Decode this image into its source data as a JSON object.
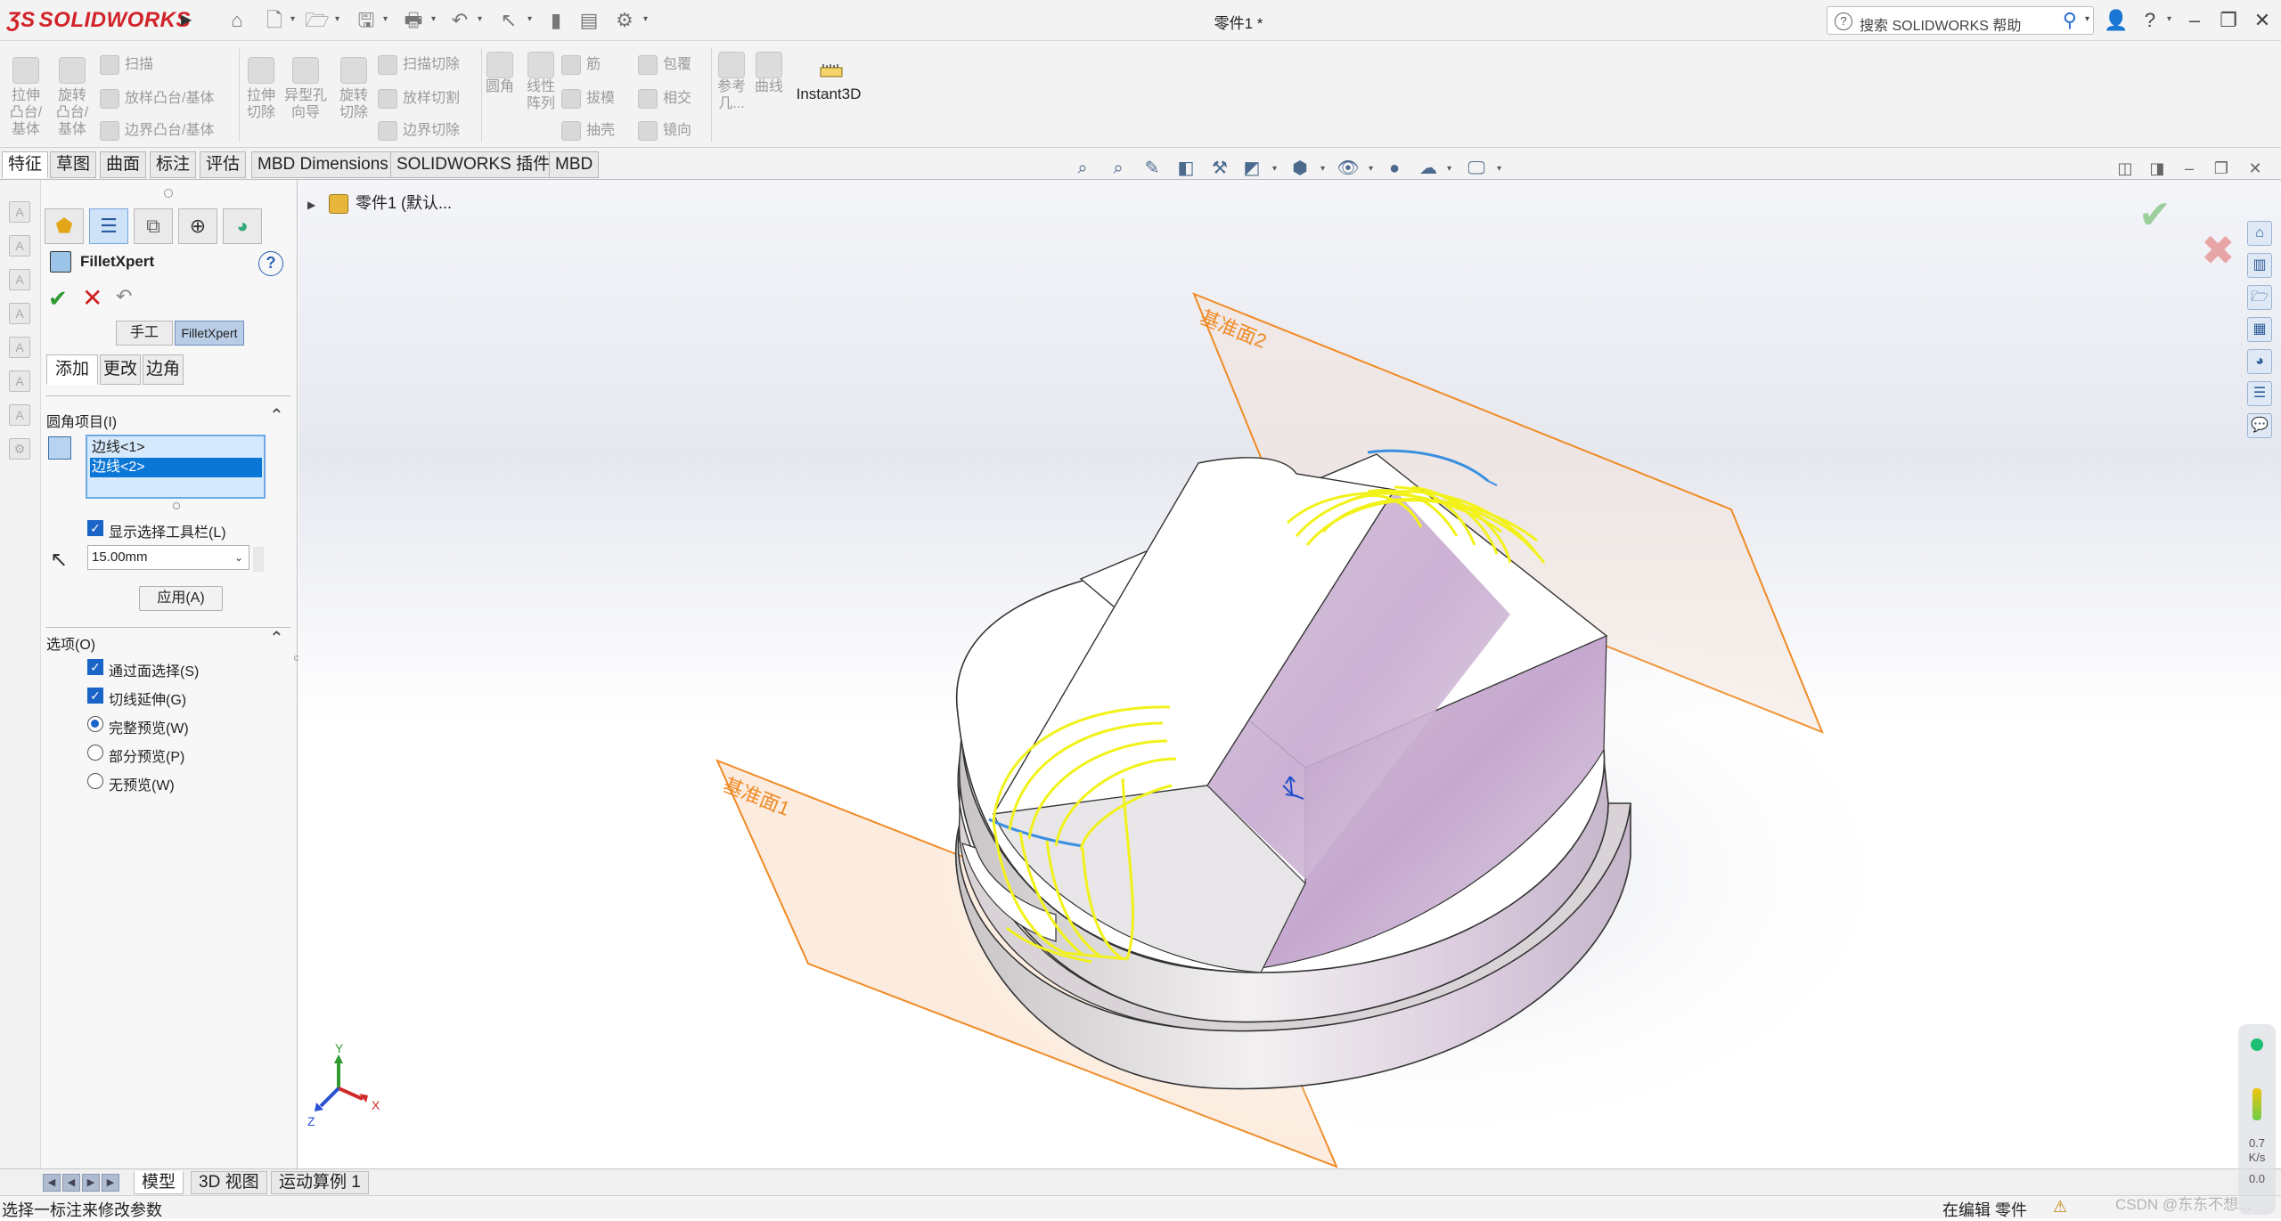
{
  "app": {
    "logo_text": "SOLIDWORKS",
    "doc_title": "零件1 *",
    "search_placeholder": "搜索 SOLIDWORKS 帮助",
    "help_icon": "?",
    "user_icon": "user-icon"
  },
  "ribbon": {
    "extrude_boss": "拉伸\n凸台/\n基体",
    "revolve_boss": "旋转\n凸台/\n基体",
    "sweep": "扫描",
    "loft_boss": "放样凸台/基体",
    "boundary_boss": "边界凸台/基体",
    "extrude_cut": "拉伸\n切除",
    "hole_wizard": "异型孔\n向导",
    "revolve_cut": "旋转\n切除",
    "sweep_cut": "扫描切除",
    "loft_cut": "放样切割",
    "boundary_cut": "边界切除",
    "fillet": "圆角",
    "linear_pattern": "线性\n阵列",
    "rib": "筋",
    "draft": "拔模",
    "shell": "抽壳",
    "wrap": "包覆",
    "intersect": "相交",
    "mirror": "镜向",
    "ref_geometry": "参考\n几...",
    "curves": "曲线",
    "instant3d": "Instant3D"
  },
  "command_tabs": [
    "特征",
    "草图",
    "曲面",
    "标注",
    "评估",
    "MBD Dimensions",
    "SOLIDWORKS 插件",
    "MBD"
  ],
  "tree": {
    "root_label": "零件1 (默认..."
  },
  "property_manager": {
    "title": "FilletXpert",
    "mode_manual": "手工",
    "mode_expert": "FilletXpert",
    "subtabs": [
      "添加",
      "更改",
      "边角"
    ],
    "fillet_items_header": "圆角项目(I)",
    "selections": [
      "边线<1>",
      "边线<2>"
    ],
    "show_toolbar_label": "显示选择工具栏(L)",
    "radius_value": "15.00mm",
    "apply_label": "应用(A)",
    "options_header": "选项(O)",
    "options": [
      {
        "label": "通过面选择(S)",
        "kind": "checkbox",
        "checked": true
      },
      {
        "label": "切线延伸(G)",
        "kind": "checkbox",
        "checked": true
      },
      {
        "label": "完整预览(W)",
        "kind": "radio",
        "checked": true
      },
      {
        "label": "部分预览(P)",
        "kind": "radio",
        "checked": false
      },
      {
        "label": "无预览(W)",
        "kind": "radio",
        "checked": false
      }
    ]
  },
  "scene": {
    "plane1_label": "基准面1",
    "plane2_label": "基准面2",
    "triad": {
      "x": "X",
      "y": "Y",
      "z": "Z"
    }
  },
  "bottom_tabs": [
    "模型",
    "3D 视图",
    "运动算例 1"
  ],
  "status": {
    "left": "选择一标注来修改参数",
    "right": "在编辑 零件",
    "watermark": "CSDN @东东不想...",
    "perf_value_1": "0.7",
    "perf_unit": "K/s",
    "perf_value_2": "0.0"
  },
  "colors": {
    "brand_red": "#d2232a",
    "plane_orange": "#f08a24",
    "fillet_preview_yellow": "#f2f21a",
    "selection_blue": "#0a76d6"
  }
}
